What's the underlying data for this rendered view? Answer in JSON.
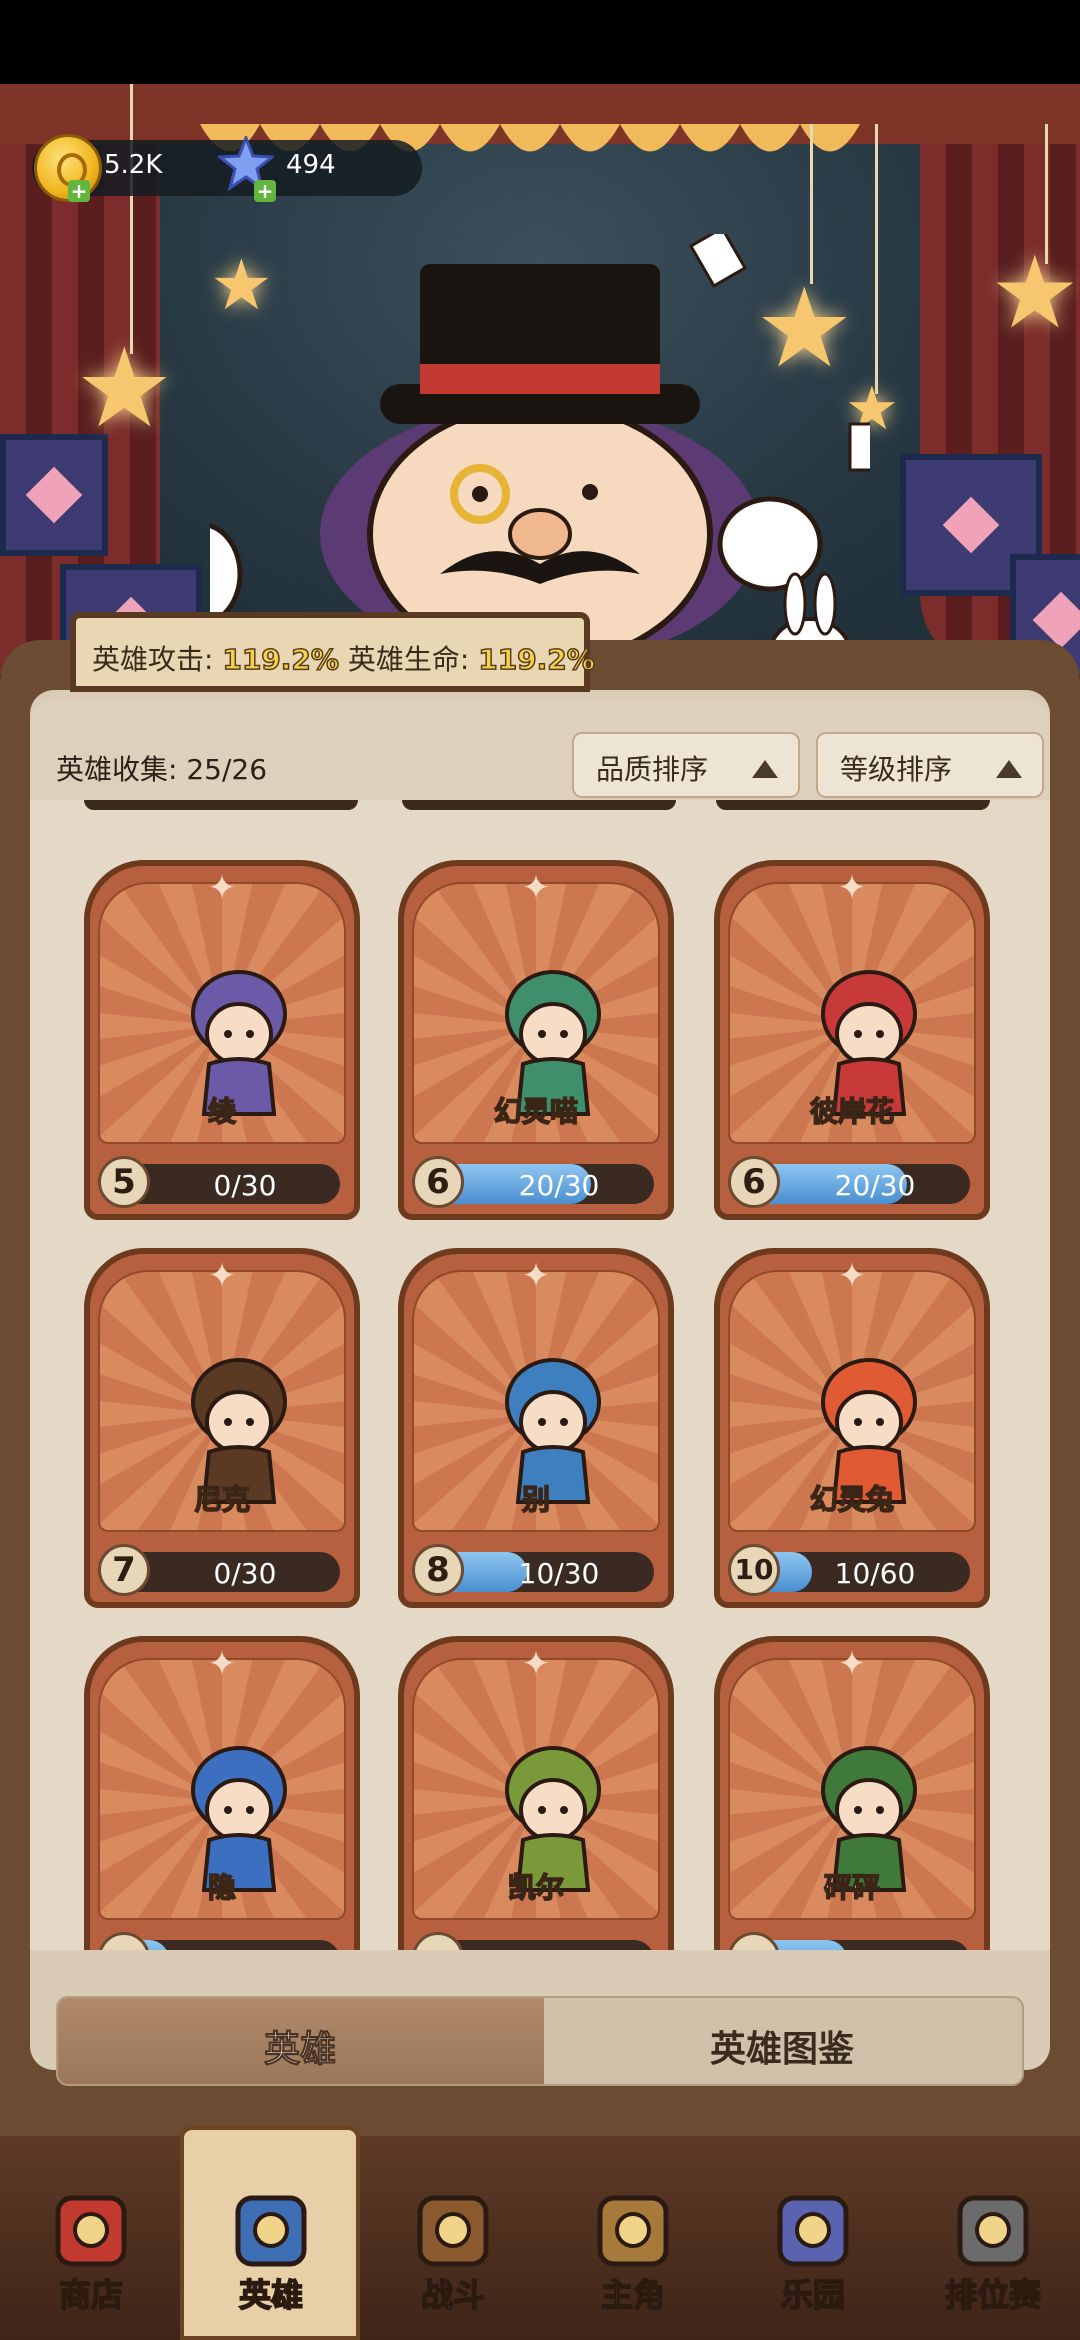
{
  "currency": {
    "gold": "5.2K",
    "gems": "494"
  },
  "stats": {
    "attack_label": "英雄攻击:",
    "attack_value": "119.2%",
    "hp_label": "英雄生命:",
    "hp_value": "119.2%"
  },
  "collection": {
    "label": "英雄收集:",
    "count": "25/26",
    "sort_quality": "品质排序",
    "sort_level": "等级排序"
  },
  "heroes": [
    {
      "name": "绫",
      "level": "5",
      "progress": "0/30",
      "fill": 0.0
    },
    {
      "name": "幻灵喵",
      "level": "6",
      "progress": "20/30",
      "fill": 0.667
    },
    {
      "name": "彼岸花",
      "level": "6",
      "progress": "20/30",
      "fill": 0.667
    },
    {
      "name": "尼克",
      "level": "7",
      "progress": "0/30",
      "fill": 0.0
    },
    {
      "name": "别",
      "level": "8",
      "progress": "10/30",
      "fill": 0.333
    },
    {
      "name": "幻灵兔",
      "level": "10",
      "progress": "10/60",
      "fill": 0.167
    },
    {
      "name": "隐",
      "level": "",
      "progress": "",
      "fill": 0.1
    },
    {
      "name": "凯尔",
      "level": "",
      "progress": "",
      "fill": 0.0
    },
    {
      "name": "砰砰",
      "level": "",
      "progress": "",
      "fill": 0.35
    }
  ],
  "tabs": {
    "heroes": "英雄",
    "codex": "英雄图鉴"
  },
  "nav": [
    {
      "label": "商店",
      "icon": "shop-icon"
    },
    {
      "label": "英雄",
      "icon": "hero-cards-icon"
    },
    {
      "label": "战斗",
      "icon": "battle-icon"
    },
    {
      "label": "主角",
      "icon": "protagonist-owl-icon"
    },
    {
      "label": "乐园",
      "icon": "castle-icon"
    },
    {
      "label": "排位赛",
      "icon": "ranked-lock-icon"
    }
  ]
}
